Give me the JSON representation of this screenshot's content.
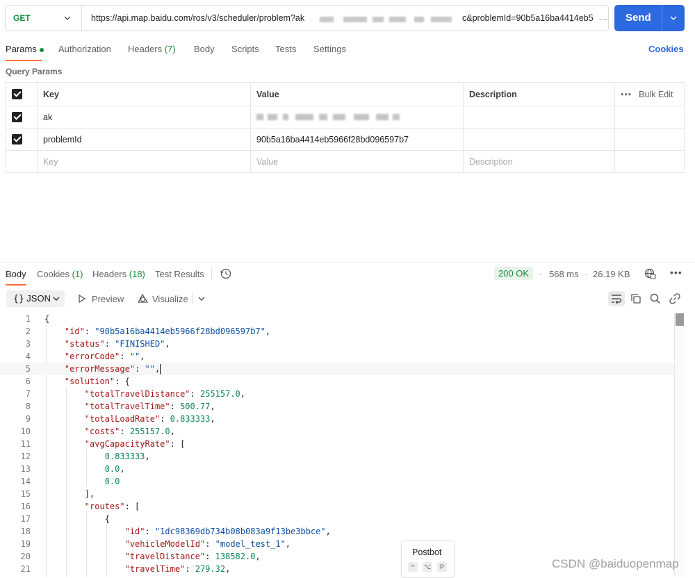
{
  "request": {
    "method": "GET",
    "url_start": "https://api.map.baidu.com/ros/v3/scheduler/problem?ak",
    "url_end": "c&problemId=90b5a16ba4414eb5",
    "url_overflow": "…",
    "send_label": "Send"
  },
  "request_tabs": {
    "params": "Params",
    "authorization": "Authorization",
    "headers": "Headers",
    "headers_count": "(7)",
    "body": "Body",
    "scripts": "Scripts",
    "tests": "Tests",
    "settings": "Settings",
    "cookies": "Cookies"
  },
  "query_params": {
    "title": "Query Params",
    "headers": {
      "key": "Key",
      "value": "Value",
      "description": "Description",
      "bulk_edit": "Bulk Edit"
    },
    "rows": [
      {
        "key": "ak",
        "value": "",
        "description": ""
      },
      {
        "key": "problemId",
        "value": "90b5a16ba4414eb5966f28bd096597b7",
        "description": ""
      }
    ],
    "placeholders": {
      "key": "Key",
      "value": "Value",
      "description": "Description"
    }
  },
  "response_tabs": {
    "body": "Body",
    "cookies": "Cookies",
    "cookies_count": "(1)",
    "headers": "Headers",
    "headers_count": "(18)",
    "test_results": "Test Results"
  },
  "response_meta": {
    "status": "200 OK",
    "time": "568 ms",
    "size": "26.19 KB",
    "bullet": "·"
  },
  "body_toolbar": {
    "format": "JSON",
    "preview": "Preview",
    "visualize": "Visualize"
  },
  "code_lines": [
    {
      "ln": "1",
      "tokens": [
        [
          "p",
          "{"
        ]
      ]
    },
    {
      "ln": "2",
      "tokens": [
        [
          "p",
          "    "
        ],
        [
          "k",
          "\"id\""
        ],
        [
          "p",
          ": "
        ],
        [
          "s",
          "\"90b5a16ba4414eb5966f28bd096597b7\""
        ],
        [
          "p",
          ","
        ]
      ]
    },
    {
      "ln": "3",
      "tokens": [
        [
          "p",
          "    "
        ],
        [
          "k",
          "\"status\""
        ],
        [
          "p",
          ": "
        ],
        [
          "s",
          "\"FINISHED\""
        ],
        [
          "p",
          ","
        ]
      ]
    },
    {
      "ln": "4",
      "tokens": [
        [
          "p",
          "    "
        ],
        [
          "k",
          "\"errorCode\""
        ],
        [
          "p",
          ": "
        ],
        [
          "s",
          "\"\""
        ],
        [
          "p",
          ","
        ]
      ]
    },
    {
      "ln": "5",
      "tokens": [
        [
          "p",
          "    "
        ],
        [
          "k",
          "\"errorMessage\""
        ],
        [
          "p",
          ": "
        ],
        [
          "s",
          "\"\""
        ],
        [
          "p",
          ","
        ]
      ]
    },
    {
      "ln": "6",
      "tokens": [
        [
          "p",
          "    "
        ],
        [
          "k",
          "\"solution\""
        ],
        [
          "p",
          ": {"
        ]
      ]
    },
    {
      "ln": "7",
      "tokens": [
        [
          "p",
          "        "
        ],
        [
          "k",
          "\"totalTravelDistance\""
        ],
        [
          "p",
          ": "
        ],
        [
          "n",
          "255157.0"
        ],
        [
          "p",
          ","
        ]
      ]
    },
    {
      "ln": "8",
      "tokens": [
        [
          "p",
          "        "
        ],
        [
          "k",
          "\"totalTravelTime\""
        ],
        [
          "p",
          ": "
        ],
        [
          "n",
          "500.77"
        ],
        [
          "p",
          ","
        ]
      ]
    },
    {
      "ln": "9",
      "tokens": [
        [
          "p",
          "        "
        ],
        [
          "k",
          "\"totalLoadRate\""
        ],
        [
          "p",
          ": "
        ],
        [
          "n",
          "0.833333"
        ],
        [
          "p",
          ","
        ]
      ]
    },
    {
      "ln": "10",
      "tokens": [
        [
          "p",
          "        "
        ],
        [
          "k",
          "\"costs\""
        ],
        [
          "p",
          ": "
        ],
        [
          "n",
          "255157.0"
        ],
        [
          "p",
          ","
        ]
      ]
    },
    {
      "ln": "11",
      "tokens": [
        [
          "p",
          "        "
        ],
        [
          "k",
          "\"avgCapacityRate\""
        ],
        [
          "p",
          ": ["
        ]
      ]
    },
    {
      "ln": "12",
      "tokens": [
        [
          "p",
          "            "
        ],
        [
          "n",
          "0.833333"
        ],
        [
          "p",
          ","
        ]
      ]
    },
    {
      "ln": "13",
      "tokens": [
        [
          "p",
          "            "
        ],
        [
          "n",
          "0.0"
        ],
        [
          "p",
          ","
        ]
      ]
    },
    {
      "ln": "14",
      "tokens": [
        [
          "p",
          "            "
        ],
        [
          "n",
          "0.0"
        ]
      ]
    },
    {
      "ln": "15",
      "tokens": [
        [
          "p",
          "        ],"
        ]
      ]
    },
    {
      "ln": "16",
      "tokens": [
        [
          "p",
          "        "
        ],
        [
          "k",
          "\"routes\""
        ],
        [
          "p",
          ": ["
        ]
      ]
    },
    {
      "ln": "17",
      "tokens": [
        [
          "p",
          "            {"
        ]
      ]
    },
    {
      "ln": "18",
      "tokens": [
        [
          "p",
          "                "
        ],
        [
          "k",
          "\"id\""
        ],
        [
          "p",
          ": "
        ],
        [
          "s",
          "\"1dc98369db734b08b083a9f13be3bbce\""
        ],
        [
          "p",
          ","
        ]
      ]
    },
    {
      "ln": "19",
      "tokens": [
        [
          "p",
          "                "
        ],
        [
          "k",
          "\"vehicleModelId\""
        ],
        [
          "p",
          ": "
        ],
        [
          "s",
          "\"model_test_1\""
        ],
        [
          "p",
          ","
        ]
      ]
    },
    {
      "ln": "20",
      "tokens": [
        [
          "p",
          "                "
        ],
        [
          "k",
          "\"travelDistance\""
        ],
        [
          "p",
          ": "
        ],
        [
          "n",
          "138582.0"
        ],
        [
          "p",
          ","
        ]
      ]
    },
    {
      "ln": "21",
      "tokens": [
        [
          "p",
          "                "
        ],
        [
          "k",
          "\"travelTime\""
        ],
        [
          "p",
          ": "
        ],
        [
          "n",
          "279.32"
        ],
        [
          "p",
          ","
        ]
      ]
    }
  ],
  "postbot": {
    "title": "Postbot",
    "keys": [
      "^",
      "⌥",
      "P"
    ]
  },
  "watermark": "CSDN @baiduopenmap",
  "colors": {
    "accent": "#2d69e0",
    "tab_underline": "#ff6c37",
    "success": "#1a8b3a",
    "json_key": "#a31515",
    "json_string": "#0b4ea2",
    "json_number": "#098658"
  },
  "icons": [
    "chevron-down-icon",
    "history-icon",
    "play-icon",
    "visualize-icon",
    "word-wrap-icon",
    "copy-icon",
    "search-icon",
    "link-icon",
    "globe-icon",
    "more-icon",
    "dots-icon"
  ]
}
